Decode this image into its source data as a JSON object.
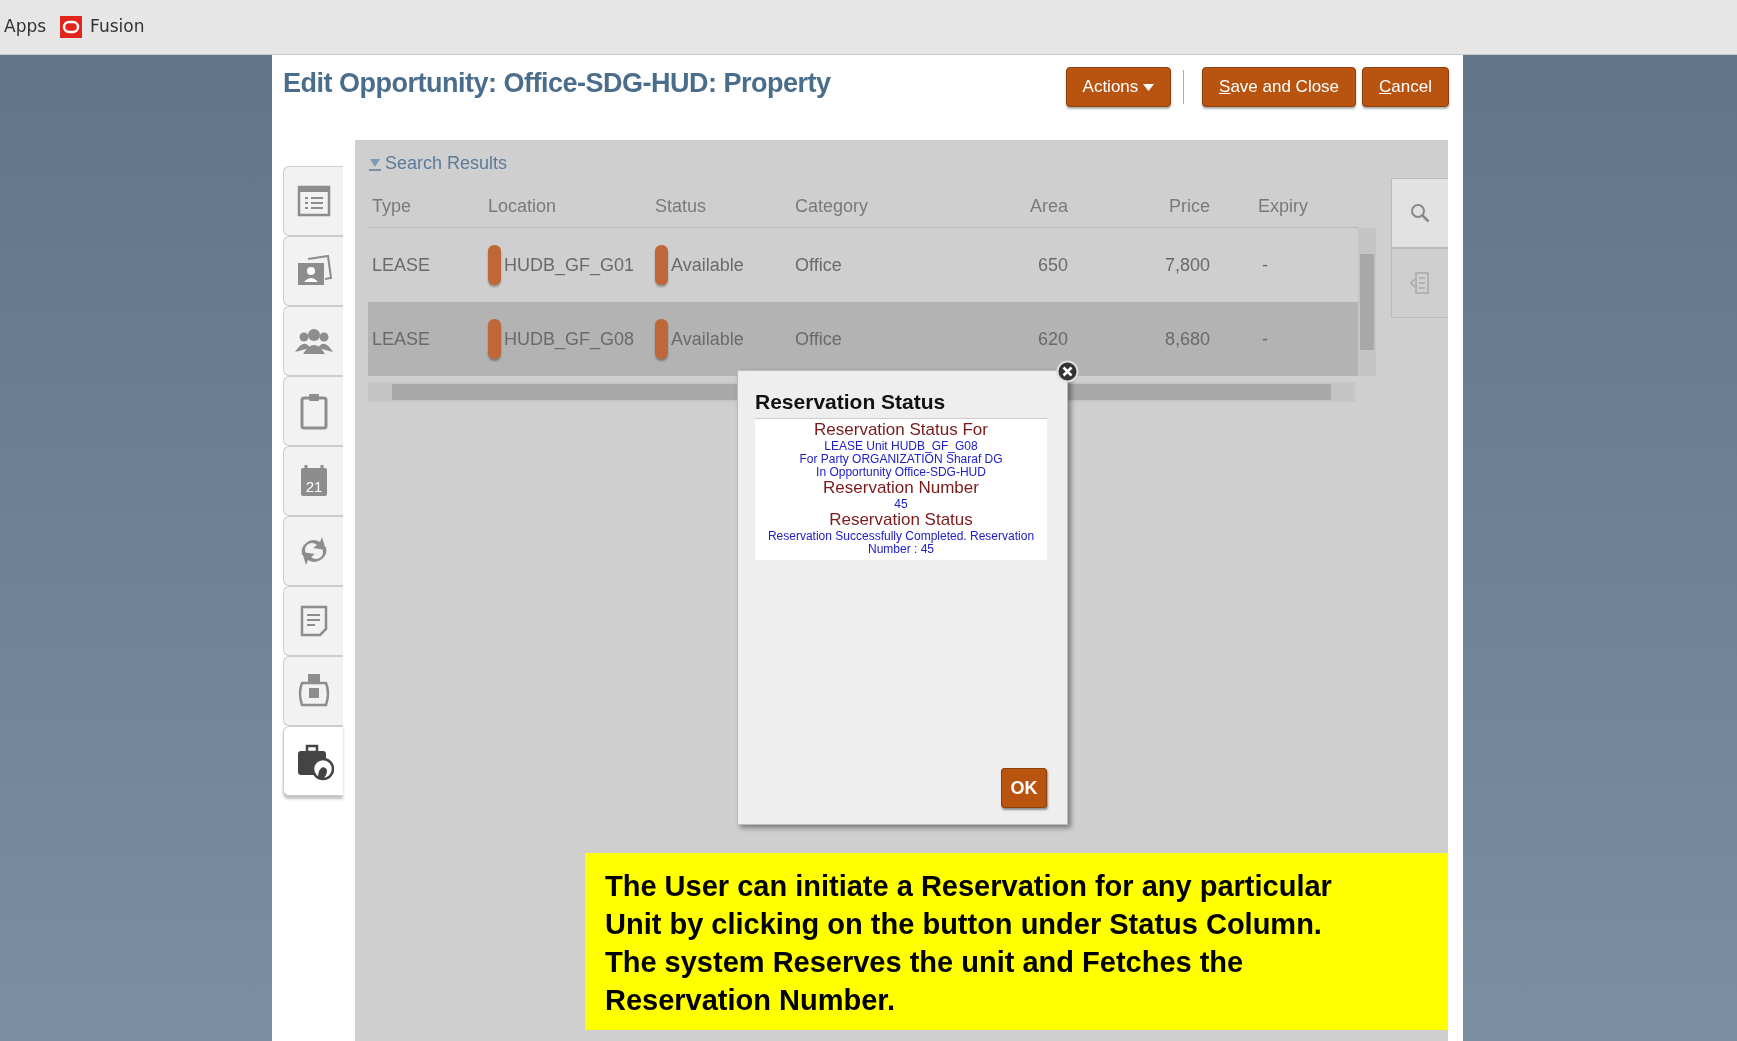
{
  "browser_bar": {
    "bookmarks": [
      {
        "kind": "text",
        "label": "Apps"
      },
      {
        "kind": "app",
        "label": "Fusion"
      }
    ]
  },
  "page": {
    "title": "Edit Opportunity: Office-SDG-HUD: Property",
    "buttons": [
      {
        "kind": "menu",
        "label": "Actions",
        "underline_first": false
      },
      {
        "kind": "action",
        "label": "Save and Close",
        "underline_first": true
      },
      {
        "kind": "action",
        "label": "Cancel",
        "underline_first": true
      }
    ]
  },
  "sidebar": {
    "tabs": [
      {
        "kind": "list",
        "selected": false
      },
      {
        "kind": "contact-card",
        "selected": false
      },
      {
        "kind": "people",
        "selected": false
      },
      {
        "kind": "clipboard",
        "selected": false
      },
      {
        "kind": "calendar",
        "label": "21",
        "selected": false
      },
      {
        "kind": "refresh",
        "selected": false
      },
      {
        "kind": "note",
        "selected": false
      },
      {
        "kind": "jar",
        "selected": false
      },
      {
        "kind": "briefcase-person",
        "selected": true
      }
    ]
  },
  "search_results": {
    "title": "Search Results",
    "expanded": true,
    "columns": [
      "Type",
      "Location",
      "Status",
      "Category",
      "Area",
      "Price",
      "Expiry"
    ],
    "rows": [
      {
        "selected": false,
        "cells": [
          "LEASE",
          "HUDB_GF_G01",
          "Available",
          "Office",
          "650",
          "7,800",
          "-"
        ]
      },
      {
        "selected": true,
        "cells": [
          "LEASE",
          "HUDB_GF_G08",
          "Available",
          "Office",
          "620",
          "8,680",
          "-"
        ]
      }
    ]
  },
  "right_tabs": [
    {
      "kind": "search"
    },
    {
      "kind": "detail"
    }
  ],
  "dialog": {
    "title": "Reservation Status",
    "lines": [
      {
        "kind": "heading",
        "text": "Reservation Status For"
      },
      {
        "kind": "value",
        "text": "LEASE Unit HUDB_GF_G08"
      },
      {
        "kind": "value",
        "text": "For Party ORGANIZATION Sharaf DG"
      },
      {
        "kind": "value",
        "text": "In Opportunity Office-SDG-HUD"
      },
      {
        "kind": "heading",
        "text": "Reservation Number"
      },
      {
        "kind": "value",
        "text": "45"
      },
      {
        "kind": "heading",
        "text": "Reservation Status"
      },
      {
        "kind": "value",
        "text": "Reservation Successfully Completed. Reservation Number : 45"
      }
    ],
    "button": "OK"
  },
  "annotation": "The User can initiate a Reservation for any particular Unit by clicking on the button under Status Column. The system Reserves the unit and Fetches the Reservation Number."
}
